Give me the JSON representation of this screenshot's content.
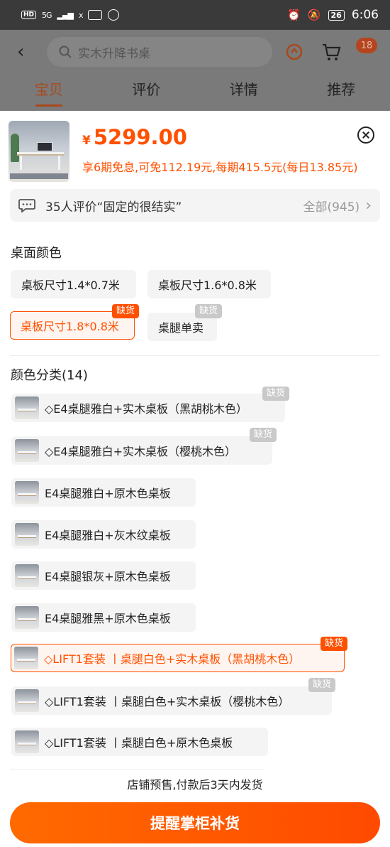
{
  "status_bar": {
    "left": {
      "hd": "HD",
      "net1": "5G",
      "net2": "x"
    },
    "battery": "26",
    "time": "6:06"
  },
  "header": {
    "search_placeholder": "实木升降书桌",
    "cart_badge": "18",
    "tabs": [
      {
        "label": "宝贝",
        "active": true
      },
      {
        "label": "评价",
        "active": false
      },
      {
        "label": "详情",
        "active": false
      },
      {
        "label": "推荐",
        "active": false
      }
    ]
  },
  "product": {
    "currency": "¥",
    "price": "5299.00",
    "promo": "享6期免息,可免112.19元,每期415.5元(每日13.85元)"
  },
  "review": {
    "text": "35人评价“固定的很结实”",
    "all_label": "全部(945)"
  },
  "section_surface": {
    "title": "桌面颜色",
    "options": [
      {
        "label": "桌板尺寸1.4*0.7米"
      },
      {
        "label": "桌板尺寸1.6*0.8米"
      },
      {
        "label": "桌板尺寸1.8*0.8米",
        "selected": true,
        "tag": "缺货"
      },
      {
        "label": "桌腿单卖",
        "tag": "缺货"
      }
    ]
  },
  "section_color": {
    "title": "颜色分类(14)",
    "options": [
      {
        "label": "◇E4桌腿雅白+实木桌板（黑胡桃木色）",
        "tag": "缺货"
      },
      {
        "label": "◇E4桌腿雅白+实木桌板（樱桃木色）",
        "tag": "缺货"
      },
      {
        "label": "E4桌腿雅白+原木色桌板"
      },
      {
        "label": "E4桌腿雅白+灰木纹桌板"
      },
      {
        "label": "E4桌腿银灰+原木色桌板"
      },
      {
        "label": "E4桌腿雅黑+原木色桌板"
      },
      {
        "label": "◇LIFT1套装 丨桌腿白色+实木桌板（黑胡桃木色）",
        "selected": true,
        "tag": "缺货"
      },
      {
        "label": "◇LIFT1套装 丨桌腿白色+实木桌板（樱桃木色）",
        "tag": "缺货"
      },
      {
        "label": "◇LIFT1套装 丨桌腿白色+原木色桌板"
      }
    ]
  },
  "footer": {
    "notice": "店铺预售,付款后3天内发货",
    "cta": "提醒掌柜补货"
  },
  "colors": {
    "accent": "#ff5000",
    "tag_gray": "#c9c9c9",
    "overlay_header": "#7a7a7a"
  },
  "icons": [
    "back-icon",
    "search-icon",
    "refresh-icon",
    "cart-icon",
    "close-icon",
    "chat-icon",
    "chevron-right-icon"
  ]
}
